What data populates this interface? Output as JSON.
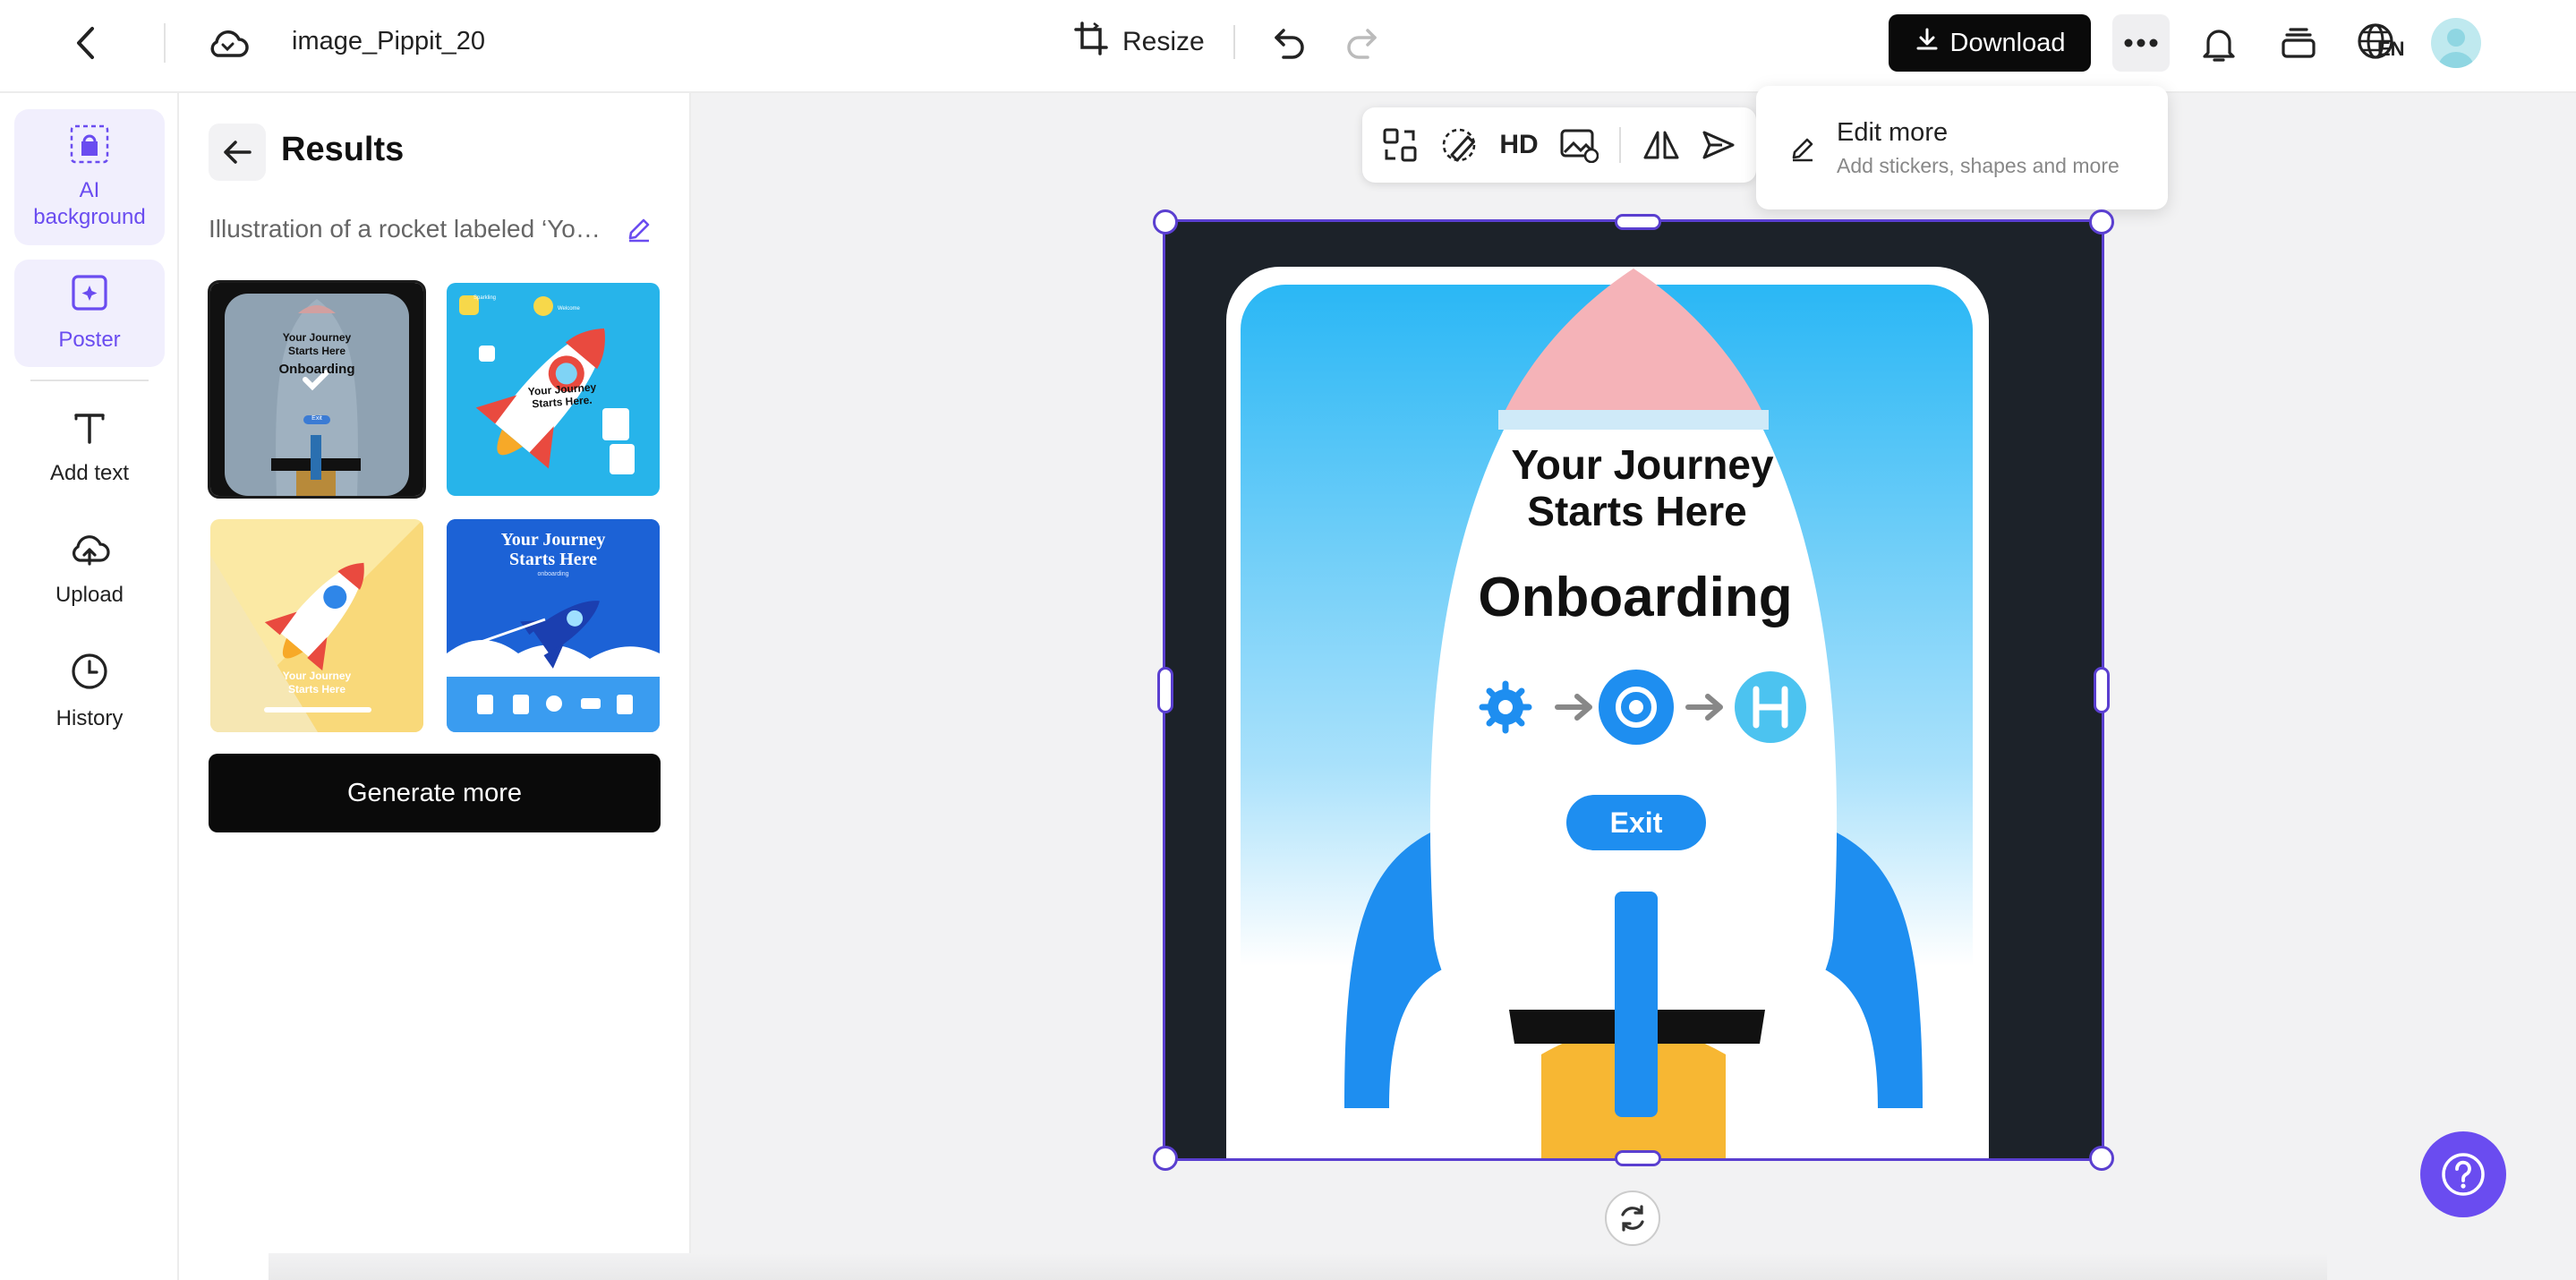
{
  "header": {
    "file_name": "image_Pippit_20",
    "resize_label": "Resize",
    "download_label": "Download",
    "language_code": "EN"
  },
  "rail": {
    "items": [
      {
        "label_line1": "AI",
        "label_line2": "background"
      },
      {
        "label": "Poster"
      },
      {
        "label": "Add text"
      },
      {
        "label": "Upload"
      },
      {
        "label": "History"
      }
    ]
  },
  "panel": {
    "title": "Results",
    "prompt": "Illustration of a rocket labeled ‘Your Journey Starts Here’",
    "generate_label": "Generate more",
    "thumbnails": [
      {
        "title_line1": "Your Journey",
        "title_line2": "Starts Here",
        "subtitle": "Onboarding",
        "button": "Exit"
      },
      {
        "title_line1": "Your Journey",
        "title_line2": "Starts Here.",
        "tag1": "Sparkling",
        "tag2": "Welcome"
      },
      {
        "title_line1": "Your Journey",
        "title_line2": "Starts Here"
      },
      {
        "title_line1": "Your Journey",
        "title_line2": "Starts Here",
        "subtitle": "onboarding"
      }
    ]
  },
  "toolbar": {
    "hd_label": "HD"
  },
  "popover": {
    "title": "Edit more",
    "subtitle": "Add stickers, shapes and more"
  },
  "poster": {
    "title_line1": "Your Journey",
    "title_line2": "Starts Here",
    "headline": "Onboarding",
    "button_label": "Exit"
  },
  "colors": {
    "accent": "#6a4cf0",
    "selection": "#5a3fd0",
    "rocket_blue": "#1e8ef0",
    "rocket_tip": "#f5b3b8",
    "flame": "#f7b733"
  }
}
